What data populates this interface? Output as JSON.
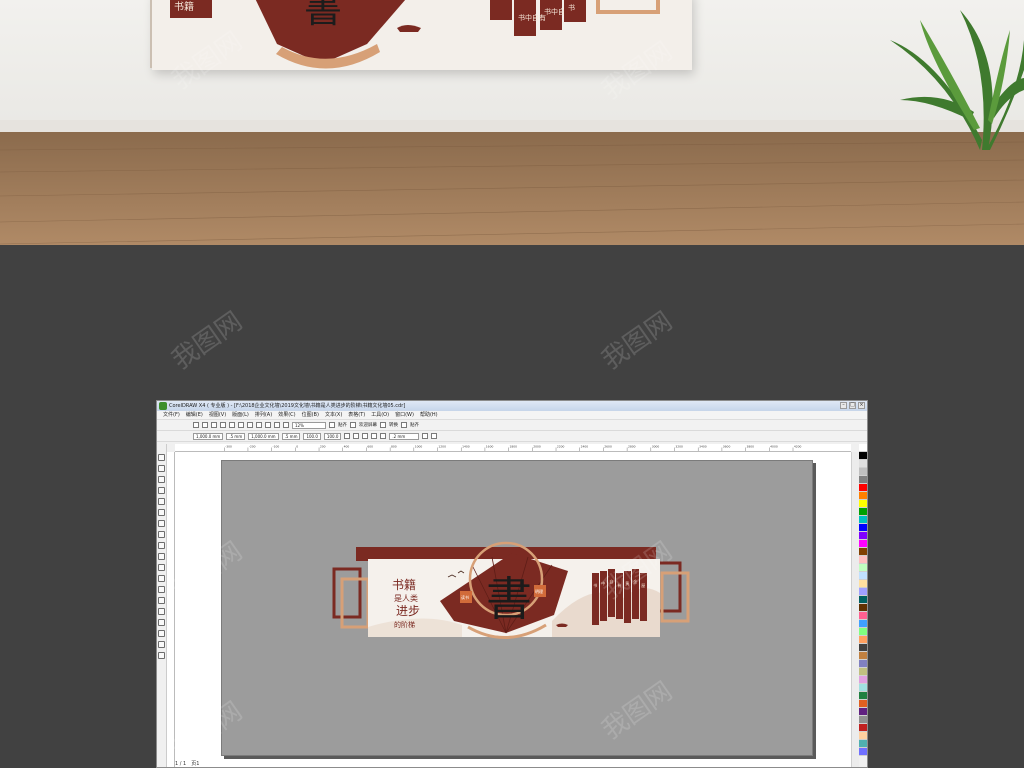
{
  "window": {
    "title": "CorelDRAW X4 ( 专业版 ) - [F:\\2018企业文化墙\\2019文化墙\\书籍是人类进步的阶梯\\书籍文化墙05.cdr]",
    "controls": [
      "–",
      "□",
      "×"
    ]
  },
  "menu": {
    "items": [
      "文件(F)",
      "编辑(E)",
      "视图(V)",
      "版面(L)",
      "排列(A)",
      "效果(C)",
      "位图(B)",
      "文本(X)",
      "表格(T)",
      "工具(O)",
      "窗口(W)",
      "帮助(H)"
    ]
  },
  "toolbar": {
    "zoom": "12%",
    "snap_label": "贴齐",
    "welcome_label": "欢迎屏幕",
    "transform_label": "转换",
    "publish_label": "贴齐"
  },
  "property_bar": {
    "width": "1,000.0 mm",
    "height": "1,000.0 mm",
    "w_small": ".5 mm",
    "h_small": ".5 mm",
    "angle": "100.0",
    "angle2": "100.0",
    "outline": ".2 mm"
  },
  "ruler": {
    "ticks": [
      "-300",
      "-200",
      "-100",
      "0",
      "200",
      "400",
      "600",
      "800",
      "1000",
      "1200",
      "1400",
      "1600",
      "1800",
      "2000",
      "2200",
      "2400",
      "2600",
      "2800",
      "3000",
      "3200",
      "3400",
      "3600",
      "3800",
      "4000",
      "4200"
    ]
  },
  "artwork": {
    "big_char": "書",
    "slogan_line1": "书籍",
    "slogan_line2": "是人类",
    "slogan_line3": "进步",
    "slogan_line4": "的阶梯",
    "seal_left": "读书",
    "seal_right": "明理",
    "panels": [
      "书",
      "中",
      "自",
      "有",
      "黄",
      "金",
      "屋"
    ],
    "board_top_left": "书籍",
    "board_panels": [
      "书中自有",
      "书中自",
      "书"
    ]
  },
  "status": {
    "page": "1 / 1",
    "page_label": "页1"
  },
  "watermark": "我图网",
  "colors": {
    "brand_red": "#7b2a22",
    "gold": "#d7a077",
    "palette": [
      "#ffffff",
      "#000000",
      "#e0e0e0",
      "#c0c0c0",
      "#808080",
      "#ff0000",
      "#ff8000",
      "#ffff00",
      "#00a000",
      "#00c0c0",
      "#0000ff",
      "#8000ff",
      "#ff00ff",
      "#804000",
      "#ffc0c0",
      "#c0ffc0",
      "#c0e0ff",
      "#ffe0a0",
      "#a0a0ff",
      "#006060",
      "#603000",
      "#ff6090",
      "#40a0ff",
      "#80ff80",
      "#ffa060",
      "#404040",
      "#c08040",
      "#8080c0",
      "#c0c080",
      "#e0a0e0",
      "#a0e0e0",
      "#208040",
      "#e06020",
      "#602080",
      "#909090",
      "#c02020",
      "#ffd0a0",
      "#50b0b0",
      "#7070ff"
    ]
  }
}
